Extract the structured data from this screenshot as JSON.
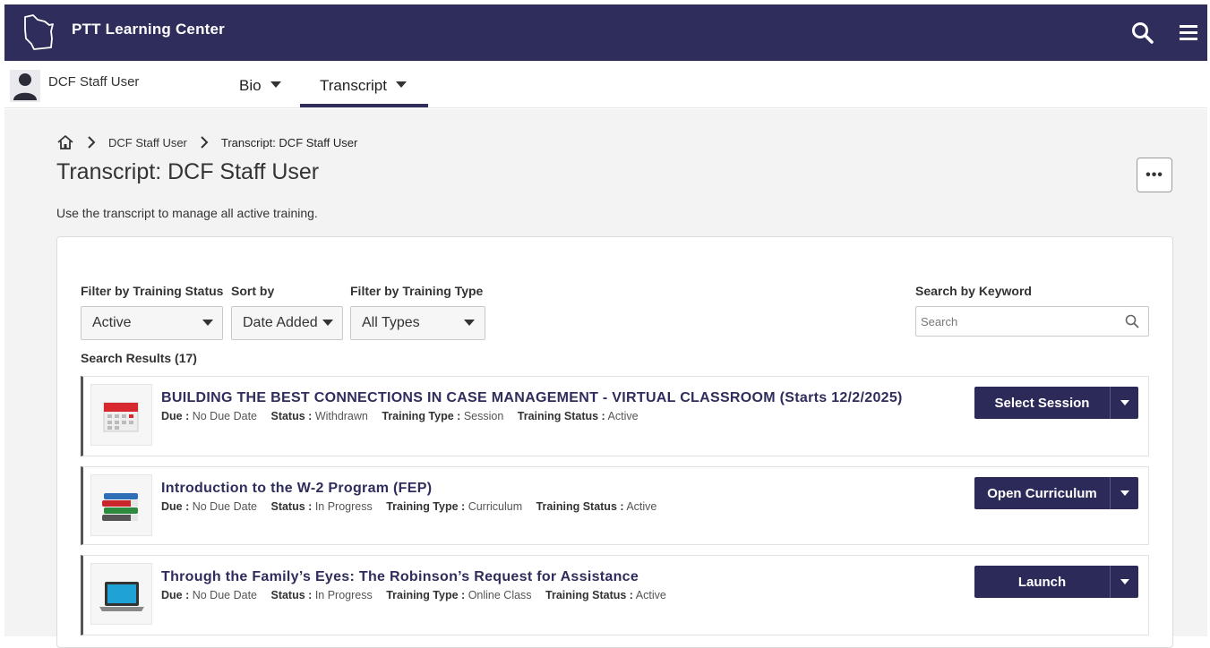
{
  "header": {
    "app_title": "PTT Learning Center"
  },
  "subnav": {
    "user_name": "DCF Staff User",
    "tabs": [
      {
        "label": "Bio"
      },
      {
        "label": "Transcript"
      }
    ]
  },
  "breadcrumb": {
    "items": [
      "DCF Staff User",
      "Transcript: DCF Staff User"
    ]
  },
  "page": {
    "title": "Transcript: DCF Staff User",
    "description": "Use the transcript to manage all active training.",
    "more_label": "•••"
  },
  "filters": {
    "status_label": "Filter by Training Status",
    "status_value": "Active",
    "sort_label": "Sort by",
    "sort_value": "Date Added",
    "type_label": "Filter by Training Type",
    "type_value": "All Types",
    "keyword_label": "Search by Keyword",
    "keyword_placeholder": "Search"
  },
  "results": {
    "count_label": "Search Results (17)",
    "meta_labels": {
      "due": "Due :",
      "status": "Status :",
      "type": "Training Type :",
      "training_status": "Training Status :"
    },
    "items": [
      {
        "title": "BUILDING THE BEST CONNECTIONS IN CASE MANAGEMENT - VIRTUAL CLASSROOM (Starts 12/2/2025)",
        "due": "No Due Date",
        "status": "Withdrawn",
        "type": "Session",
        "training_status": "Active",
        "action": "Select Session",
        "icon": "calendar-icon"
      },
      {
        "title": "Introduction to the W-2 Program (FEP)",
        "due": "No Due Date",
        "status": "In Progress",
        "type": "Curriculum",
        "training_status": "Active",
        "action": "Open Curriculum",
        "icon": "books-icon"
      },
      {
        "title": "Through the Family’s Eyes: The Robinson’s Request for Assistance",
        "due": "No Due Date",
        "status": "In Progress",
        "type": "Online Class",
        "training_status": "Active",
        "action": "Launch",
        "icon": "laptop-icon"
      }
    ]
  },
  "colors": {
    "header_bg": "#2f2d5c",
    "button_bg": "#2c2a58",
    "title_text": "#2f2d5c"
  }
}
